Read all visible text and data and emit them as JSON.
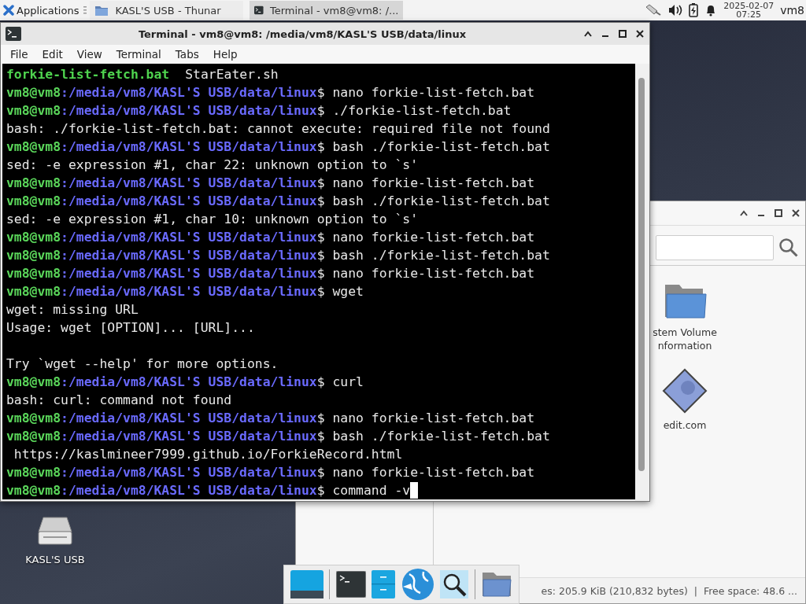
{
  "panel": {
    "apps_menu": "Applications",
    "tasks": [
      {
        "title": "KASL'S USB - Thunar",
        "kind": "folder",
        "selected": false
      },
      {
        "title": "Terminal - vm8@vm8: /...",
        "kind": "terminal",
        "selected": true
      }
    ],
    "clock": {
      "date": "2025-02-07",
      "time": "07:25"
    },
    "user": "vm8"
  },
  "file_manager": {
    "items": [
      {
        "name": "stem Volume nformation",
        "kind": "folder"
      },
      {
        "name": "edit.com",
        "kind": "program"
      }
    ],
    "status": "es: 205.9 KiB (210,832 bytes)  |  Free space: 48.6 ..."
  },
  "desktop": {
    "icons": [
      {
        "label": "KASL'S USB",
        "kind": "drive"
      }
    ]
  },
  "terminal": {
    "title": "Terminal - vm8@vm8: /media/vm8/KASL'S USB/data/linux",
    "menu": [
      "File",
      "Edit",
      "View",
      "Terminal",
      "Tabs",
      "Help"
    ],
    "lines": [
      {
        "kind": "ls",
        "files": [
          {
            "name": "forkie-list-fetch.bat",
            "color": "#4fd44f"
          },
          {
            "name": "StarEater.sh",
            "color": "#e8e8e8"
          }
        ]
      },
      {
        "kind": "prompt",
        "user": "vm8@vm8",
        "path": ":/media/vm8/KASL'S USB/data/linux",
        "command": "$ nano forkie-list-fetch.bat",
        "cursor": false
      },
      {
        "kind": "prompt",
        "user": "vm8@vm8",
        "path": ":/media/vm8/KASL'S USB/data/linux",
        "command": "$ ./forkie-list-fetch.bat",
        "cursor": false
      },
      {
        "kind": "output",
        "text": "bash: ./forkie-list-fetch.bat: cannot execute: required file not found"
      },
      {
        "kind": "prompt",
        "user": "vm8@vm8",
        "path": ":/media/vm8/KASL'S USB/data/linux",
        "command": "$ bash ./forkie-list-fetch.bat",
        "cursor": false
      },
      {
        "kind": "output",
        "text": "sed: -e expression #1, char 22: unknown option to `s'"
      },
      {
        "kind": "prompt",
        "user": "vm8@vm8",
        "path": ":/media/vm8/KASL'S USB/data/linux",
        "command": "$ nano forkie-list-fetch.bat",
        "cursor": false
      },
      {
        "kind": "prompt",
        "user": "vm8@vm8",
        "path": ":/media/vm8/KASL'S USB/data/linux",
        "command": "$ bash ./forkie-list-fetch.bat",
        "cursor": false
      },
      {
        "kind": "output",
        "text": "sed: -e expression #1, char 10: unknown option to `s'"
      },
      {
        "kind": "prompt",
        "user": "vm8@vm8",
        "path": ":/media/vm8/KASL'S USB/data/linux",
        "command": "$ nano forkie-list-fetch.bat",
        "cursor": false
      },
      {
        "kind": "prompt",
        "user": "vm8@vm8",
        "path": ":/media/vm8/KASL'S USB/data/linux",
        "command": "$ bash ./forkie-list-fetch.bat",
        "cursor": false
      },
      {
        "kind": "prompt",
        "user": "vm8@vm8",
        "path": ":/media/vm8/KASL'S USB/data/linux",
        "command": "$ nano forkie-list-fetch.bat",
        "cursor": false
      },
      {
        "kind": "prompt",
        "user": "vm8@vm8",
        "path": ":/media/vm8/KASL'S USB/data/linux",
        "command": "$ wget",
        "cursor": false
      },
      {
        "kind": "output",
        "text": "wget: missing URL"
      },
      {
        "kind": "output",
        "text": "Usage: wget [OPTION]... [URL]..."
      },
      {
        "kind": "blank"
      },
      {
        "kind": "output",
        "text": "Try `wget --help' for more options."
      },
      {
        "kind": "prompt",
        "user": "vm8@vm8",
        "path": ":/media/vm8/KASL'S USB/data/linux",
        "command": "$ curl",
        "cursor": false
      },
      {
        "kind": "output",
        "text": "bash: curl: command not found"
      },
      {
        "kind": "prompt",
        "user": "vm8@vm8",
        "path": ":/media/vm8/KASL'S USB/data/linux",
        "command": "$ nano forkie-list-fetch.bat",
        "cursor": false
      },
      {
        "kind": "prompt",
        "user": "vm8@vm8",
        "path": ":/media/vm8/KASL'S USB/data/linux",
        "command": "$ bash ./forkie-list-fetch.bat",
        "cursor": false
      },
      {
        "kind": "output",
        "text": " https://kaslmineer7999.github.io/ForkieRecord.html"
      },
      {
        "kind": "prompt",
        "user": "vm8@vm8",
        "path": ":/media/vm8/KASL'S USB/data/linux",
        "command": "$ nano forkie-list-fetch.bat",
        "cursor": false
      },
      {
        "kind": "prompt",
        "user": "vm8@vm8",
        "path": ":/media/vm8/KASL'S USB/data/linux",
        "command": "$ command -v",
        "cursor": true
      }
    ]
  }
}
